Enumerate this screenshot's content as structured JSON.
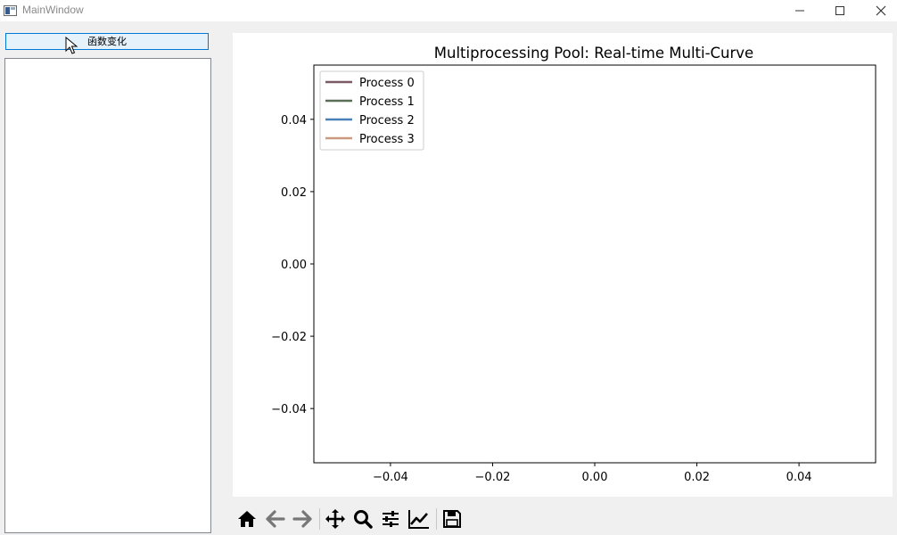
{
  "window": {
    "title": "MainWindow"
  },
  "left_panel": {
    "function_button_label": "函数变化",
    "list_items": []
  },
  "colors": {
    "accent_border": "#0078d7",
    "button_bg": "#e5f1fb",
    "process_0": "#7a5a63",
    "process_1": "#5a6e57",
    "process_2": "#4a80b8",
    "process_3": "#c99a80"
  },
  "toolbar": {
    "icons": [
      "home-icon",
      "back-arrow-icon",
      "forward-arrow-icon",
      "pan-icon",
      "zoom-icon",
      "configure-subplots-icon",
      "edit-axis-icon",
      "save-icon"
    ]
  },
  "chart_data": {
    "type": "line",
    "title": "Multiprocessing Pool: Real-time Multi-Curve",
    "xlabel": "",
    "ylabel": "",
    "xlim": [
      -0.055,
      0.055
    ],
    "ylim": [
      -0.055,
      0.055
    ],
    "xticks": [
      -0.04,
      -0.02,
      0.0,
      0.02,
      0.04
    ],
    "yticks": [
      0.04,
      0.02,
      0.0,
      -0.02,
      -0.04
    ],
    "xtick_labels": [
      "−0.04",
      "−0.02",
      "0.00",
      "0.02",
      "0.04"
    ],
    "ytick_labels": [
      "0.04",
      "0.02",
      "0.00",
      "−0.02",
      "−0.04"
    ],
    "grid": false,
    "legend_position": "top-left",
    "series": [
      {
        "name": "Process 0",
        "color": "#7a5a63",
        "x": [],
        "y": []
      },
      {
        "name": "Process 1",
        "color": "#5a6e57",
        "x": [],
        "y": []
      },
      {
        "name": "Process 2",
        "color": "#4a80b8",
        "x": [],
        "y": []
      },
      {
        "name": "Process 3",
        "color": "#c99a80",
        "x": [],
        "y": []
      }
    ]
  }
}
